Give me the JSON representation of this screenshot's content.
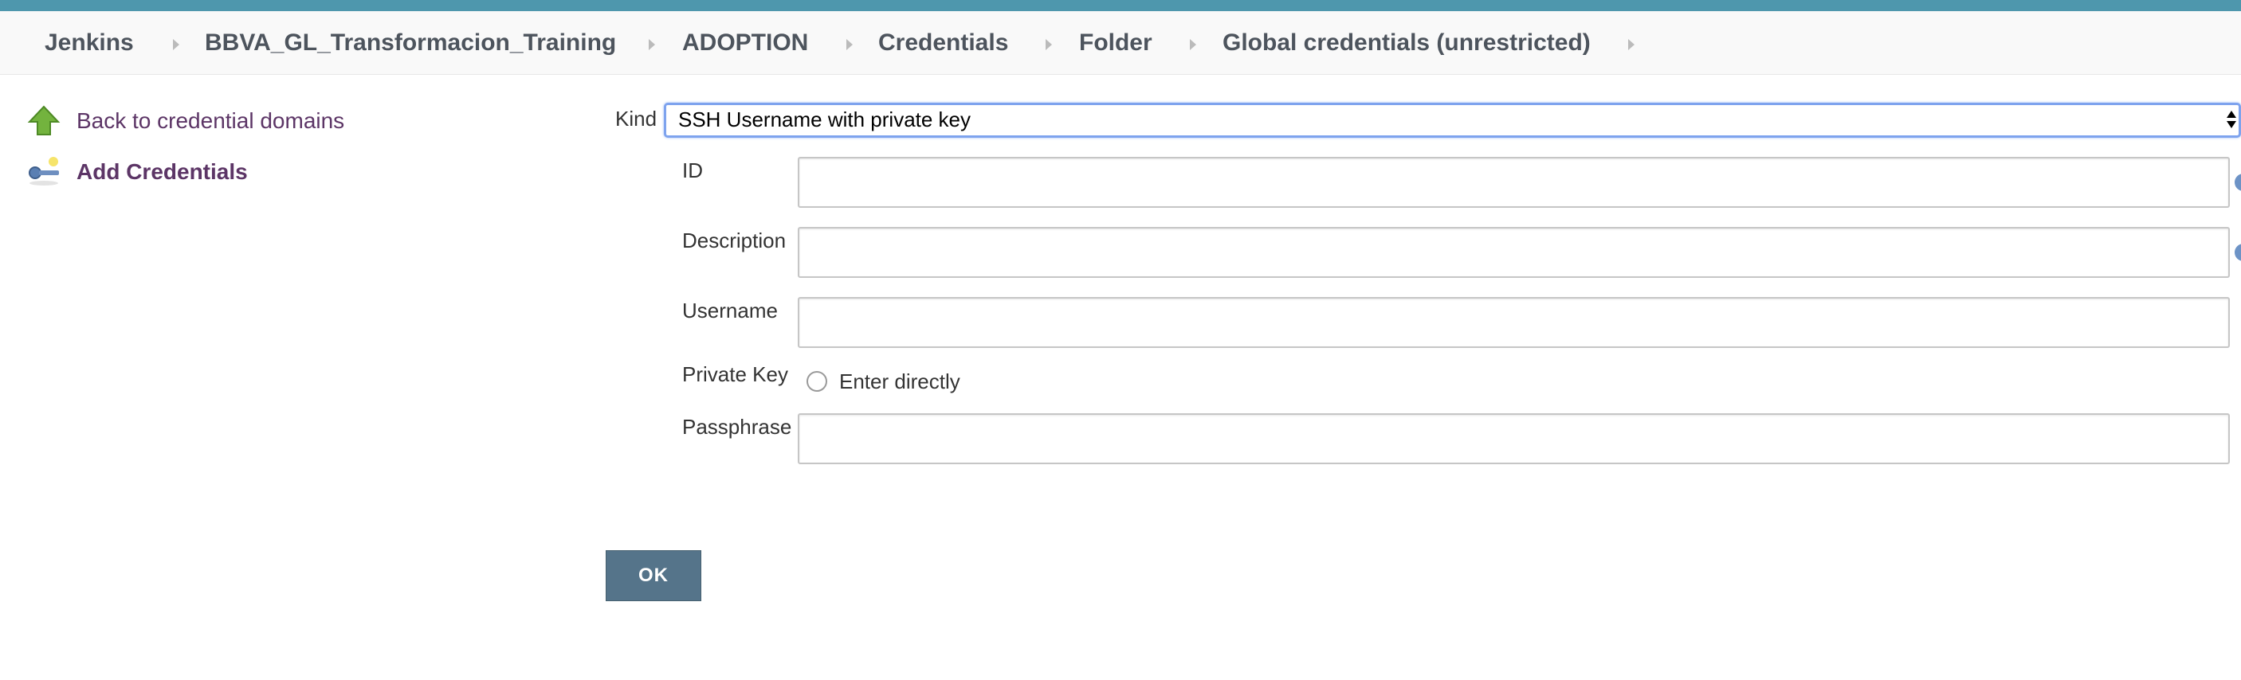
{
  "colors": {
    "topbar": "#4e97ad",
    "link": "#5c3566",
    "button": "#55748a",
    "select_focus": "#7ea3ee"
  },
  "breadcrumb": [
    {
      "label": "Jenkins"
    },
    {
      "label": "BBVA_GL_Transformacion_Training"
    },
    {
      "label": "ADOPTION"
    },
    {
      "label": "Credentials"
    },
    {
      "label": "Folder"
    },
    {
      "label": "Global credentials (unrestricted)"
    }
  ],
  "sidebar": {
    "items": [
      {
        "label": "Back to credential domains",
        "icon": "up-arrow-icon"
      },
      {
        "label": "Add Credentials",
        "icon": "key-icon"
      }
    ]
  },
  "form": {
    "kind": {
      "label": "Kind",
      "value": "SSH Username with private key"
    },
    "id": {
      "label": "ID",
      "value": ""
    },
    "description": {
      "label": "Description",
      "value": ""
    },
    "username": {
      "label": "Username",
      "value": ""
    },
    "private_key": {
      "label": "Private Key",
      "option": "Enter directly"
    },
    "passphrase": {
      "label": "Passphrase",
      "value": ""
    }
  },
  "ok_label": "OK"
}
